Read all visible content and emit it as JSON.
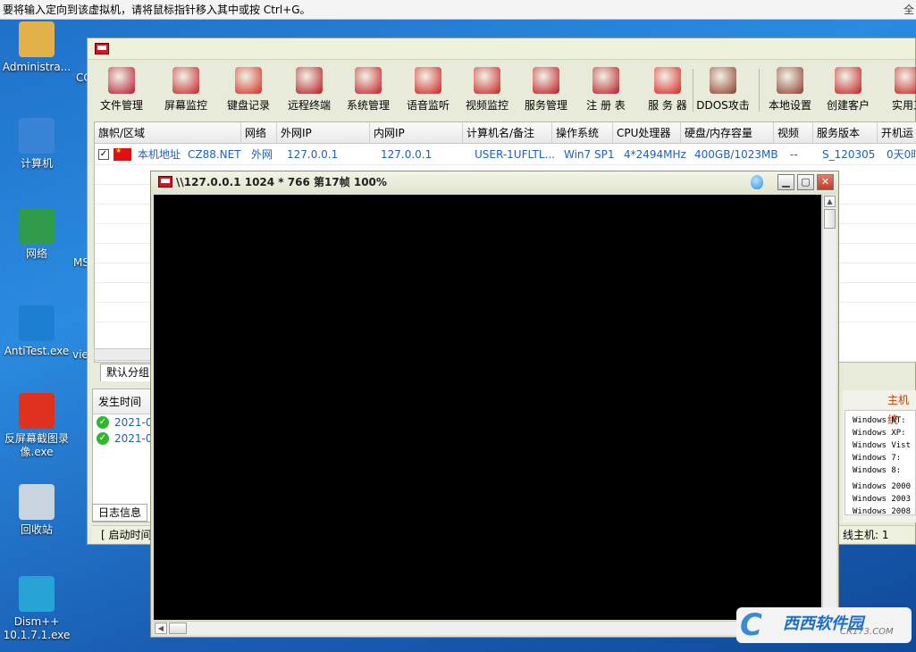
{
  "vm_hint": "要将输入定向到该虚拟机，请将鼠标指针移入其中或按 Ctrl+G。",
  "vm_hint_right": "全",
  "desktop": {
    "icons": [
      {
        "label": "Administra...",
        "icon": "user-folder-icon",
        "color": "#e2b14a"
      },
      {
        "label": "计算机",
        "icon": "computer-icon",
        "color": "#3a84d8"
      },
      {
        "label": "网络",
        "icon": "network-globe-icon",
        "color": "#2f9b4b"
      },
      {
        "label": "AntiTest.exe",
        "icon": "s-logo-icon",
        "color": "#1d7fd1"
      },
      {
        "label": "反屏幕截图录像.exe",
        "icon": "no-camera-icon",
        "color": "#e0301e"
      },
      {
        "label": "回收站",
        "icon": "recycle-bin-icon",
        "color": "#c8d4e0"
      },
      {
        "label": "Dism++ 10.1.7.1.exe",
        "icon": "gears-icon",
        "color": "#27a3d6"
      }
    ],
    "peek": [
      "CC",
      "MS",
      "vie"
    ]
  },
  "app": {
    "toolbar": [
      {
        "label": "文件管理",
        "icon": "file-manager-icon",
        "color": "#b8162a"
      },
      {
        "label": "屏幕监控",
        "icon": "screen-monitor-icon",
        "color": "#c61e24"
      },
      {
        "label": "键盘记录",
        "icon": "keyboard-log-icon",
        "color": "#d42a1e"
      },
      {
        "label": "远程终端",
        "icon": "terminal-icon",
        "color": "#b3151d"
      },
      {
        "label": "系统管理",
        "icon": "system-manage-icon",
        "color": "#c7181f"
      },
      {
        "label": "语音监听",
        "icon": "audio-listen-icon",
        "color": "#d01b1b"
      },
      {
        "label": "视频监控",
        "icon": "video-monitor-icon",
        "color": "#c81d1d"
      },
      {
        "label": "服务管理",
        "icon": "service-manage-icon",
        "color": "#c0141c"
      },
      {
        "label": "注 册 表",
        "icon": "registry-icon",
        "color": "#b91622"
      },
      {
        "label": "服 务 器",
        "icon": "server-icon",
        "color": "#d8201e"
      },
      {
        "label": "DDOS攻击",
        "icon": "ddos-icon",
        "color": "#8e3a2a"
      },
      {
        "label": "本地设置",
        "icon": "local-settings-icon",
        "color": "#8e3a2a"
      },
      {
        "label": "创建客户",
        "icon": "create-client-icon",
        "color": "#c41a1a"
      },
      {
        "label": "实用工",
        "icon": "tools-icon",
        "color": "#c41a1a"
      }
    ],
    "columns": [
      "旗帜/区域",
      "网络",
      "外网IP",
      "内网IP",
      "计算机名/备注",
      "操作系统",
      "CPU处理器",
      "硬盘/内存容量",
      "视频",
      "服务版本",
      "开机运"
    ],
    "row": {
      "checked": "✓",
      "region": "本机地址",
      "region_isp": "CZ88.NET",
      "network": "外网",
      "wan_ip": "127.0.0.1",
      "lan_ip": "127.0.0.1",
      "hostname": "USER-1UFLTL...",
      "os": "Win7 SP1",
      "cpu": "4*2494MHz",
      "disk_mem": "400GB/1023MB",
      "video": "--",
      "version": "S_120305",
      "uptime": "0天0时"
    },
    "group_tab": "默认分组",
    "log": {
      "header": "发生时间",
      "rows": [
        "2021-0",
        "2021-0"
      ],
      "tab": "日志信息"
    },
    "status_left": "[ 启动时间",
    "status_right": "线主机: 1",
    "info_panel": {
      "title": "主机统",
      "lines": [
        "Windows NT:",
        "Windows XP:",
        "Windows Vist",
        "Windows 7:",
        "Windows 8:",
        "Windows 2000",
        "Windows 2003",
        "Windows 2008"
      ]
    }
  },
  "remote_window": {
    "title": "\\\\127.0.0.1 1024 * 766 第17帧 100%"
  },
  "watermark": {
    "mark": "C",
    "main": "西西软件园",
    "sub": "CR173.COM"
  }
}
